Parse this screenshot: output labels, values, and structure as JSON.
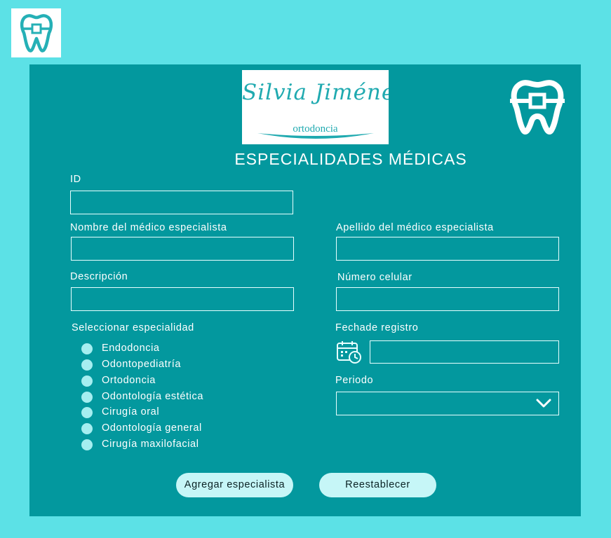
{
  "colors": {
    "page_bg": "#5ce1e6",
    "panel_bg": "#03989e",
    "accent": "#20aab0",
    "radio": "#a5eef0",
    "button": "#c6f6f7"
  },
  "icons": [
    "tooth-braces-icon",
    "calendar-clock-icon",
    "chevron-down-icon"
  ],
  "brand": {
    "name": "Silvia Jiménez",
    "subtitle": "ortodoncia"
  },
  "page_title": "ESPECIALIDADES MÉDICAS",
  "form": {
    "id_label": "ID",
    "first_name_label": "Nombre del médico especialista",
    "last_name_label": "Apellido del médico especialista",
    "description_label": "Descripción",
    "phone_label": "Número celular",
    "specialty_label": "Seleccionar especialidad",
    "date_label": "Fechade registro",
    "period_label": "Periodo",
    "specialties": [
      "Endodoncia",
      "Odontopediatría",
      "Ortodoncia",
      "Odontología estética",
      "Cirugía oral",
      "Odontología general",
      "Cirugía maxilofacial"
    ]
  },
  "buttons": {
    "add": "Agregar especialista",
    "reset": "Reestablecer"
  }
}
